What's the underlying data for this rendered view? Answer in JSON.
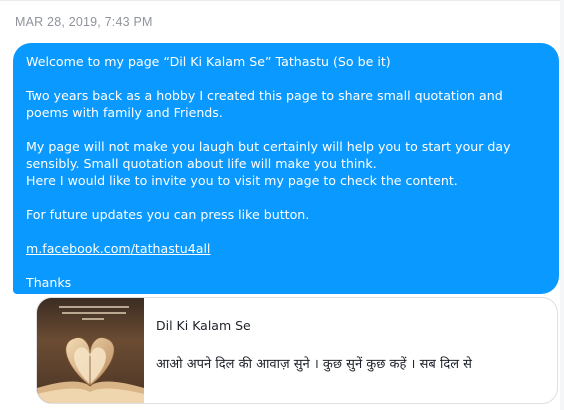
{
  "timestamp": "MAR 28, 2019, 7:43 PM",
  "message": {
    "line1": "Welcome to my page “Dil Ki Kalam Se” Tathastu (So be it)",
    "line2": "Two years back as a hobby I created this page to share small quotation and poems with family and Friends.",
    "line3": "My page will not make you laugh but certainly will help you to start your day sensibly. Small quotation about life will make you think.",
    "line4": "Here I would like to invite you to visit my page to check the content.",
    "line5": "For future updates you can press like button.",
    "link": "m.facebook.com/tathastu4all",
    "signoff": "Thanks",
    "bubble_color": "#0a99ff"
  },
  "link_preview": {
    "title": "Dil Ki Kalam Se",
    "description": "आओ अपने दिल की आवाज़ सुने । कुछ सुनें कुछ कहें । सब दिल से",
    "thumbnail_icon": "book-heart-image"
  }
}
